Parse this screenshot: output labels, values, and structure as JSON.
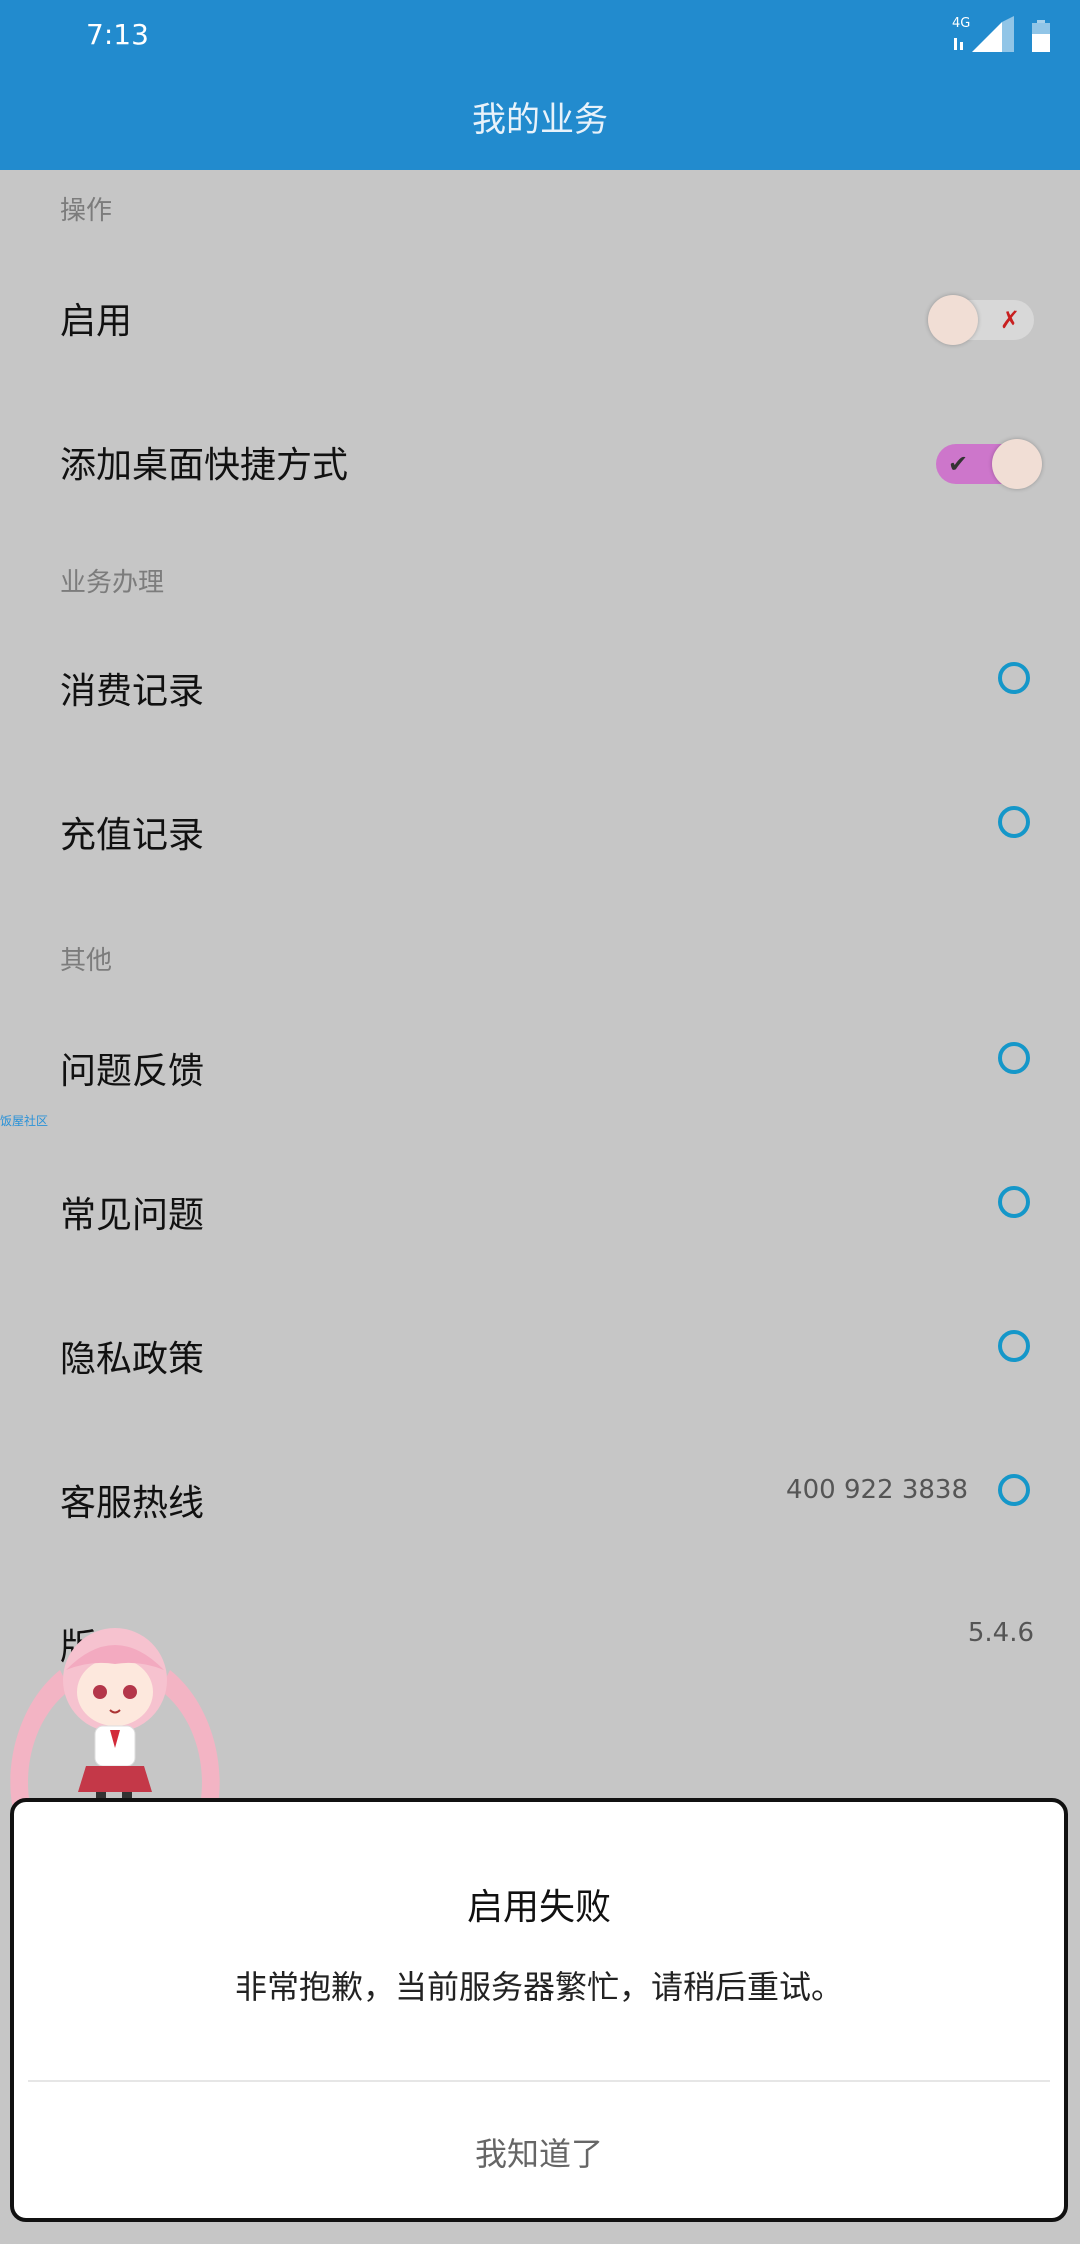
{
  "status": {
    "time": "7:13",
    "network": "4G"
  },
  "appbar": {
    "title": "我的业务"
  },
  "sections": {
    "operate": "操作",
    "business": "业务办理",
    "other": "其他"
  },
  "rows": {
    "enable": {
      "label": "启用"
    },
    "shortcut": {
      "label": "添加桌面快捷方式"
    },
    "consumption": {
      "label": "消费记录"
    },
    "recharge": {
      "label": "充值记录"
    },
    "feedback": {
      "label": "问题反馈"
    },
    "faq": {
      "label": "常见问题"
    },
    "privacy": {
      "label": "隐私政策"
    },
    "hotline": {
      "label": "客服热线",
      "value": "400 922 3838"
    },
    "version": {
      "label": "版本",
      "value": "5.4.6"
    }
  },
  "toggles": {
    "enable_on": false,
    "shortcut_on": true
  },
  "watermark": "饭屋社区",
  "dialog": {
    "title": "启用失败",
    "message": "非常抱歉，当前服务器繁忙，请稍后重试。",
    "button": "我知道了"
  },
  "colors": {
    "appbar": "#228bce",
    "ring": "#1597c9",
    "toggle_on": "#cd76cb",
    "background": "#c6c6c6"
  }
}
